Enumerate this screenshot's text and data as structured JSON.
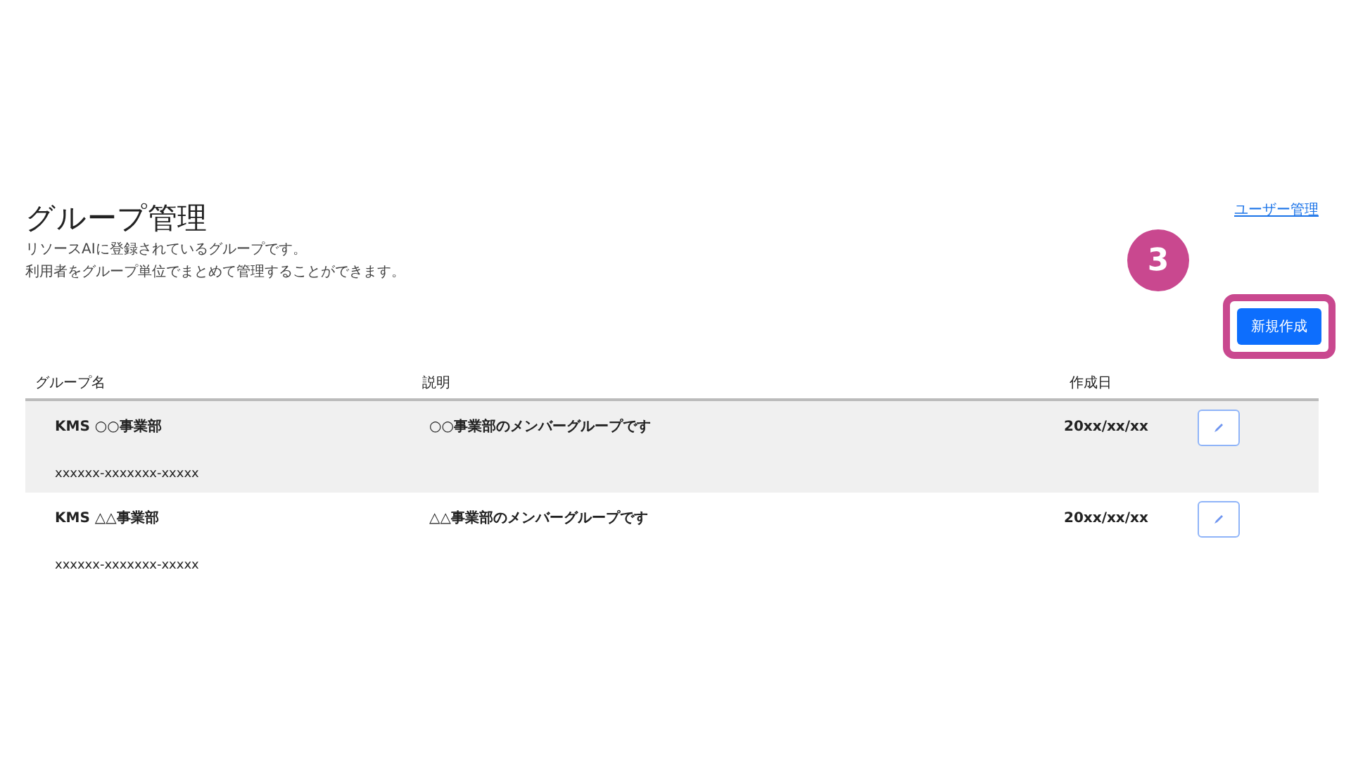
{
  "page": {
    "title": "グループ管理",
    "description": [
      "リソースAIに登録されているグループです。",
      "利用者をグループ単位でまとめて管理することができます。"
    ],
    "user_link": "ユーザー管理",
    "create_button": "新規作成"
  },
  "annotation": {
    "step": "3"
  },
  "table": {
    "columns": [
      "グループ名",
      "説明",
      "作成日"
    ],
    "rows": [
      {
        "name": "KMS ○○事業部",
        "id": "xxxxxx-xxxxxxx-xxxxx",
        "description": "○○事業部のメンバーグループです",
        "created": "20xx/xx/xx",
        "selected": true
      },
      {
        "name": "KMS △△事業部",
        "id": "xxxxxx-xxxxxxx-xxxxx",
        "description": "△△事業部のメンバーグループです",
        "created": "20xx/xx/xx",
        "selected": false
      }
    ]
  }
}
